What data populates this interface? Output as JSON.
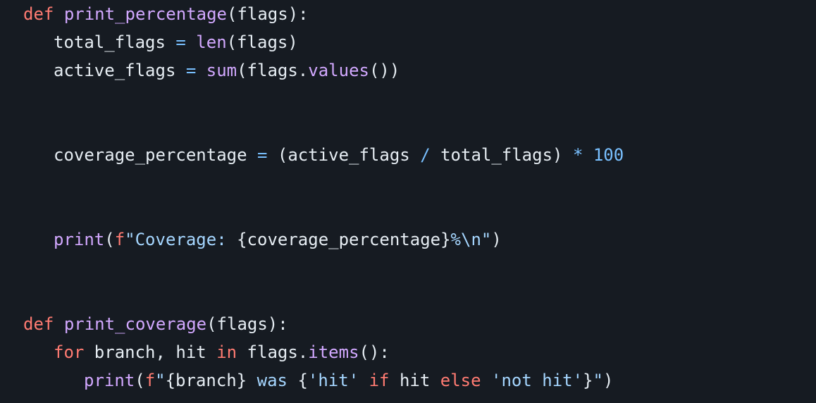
{
  "theme": {
    "background": "#161b22",
    "foreground": "#e6edf3",
    "keyword": "#ff7b72",
    "function": "#d2a8ff",
    "string": "#a5d6ff",
    "number": "#79c0ff",
    "operator": "#79c0ff"
  },
  "code": {
    "language": "python",
    "lines": [
      {
        "indent": 0,
        "tokens": [
          {
            "t": "def",
            "k": "kw"
          },
          {
            "t": " ",
            "k": "plain"
          },
          {
            "t": "print_percentage",
            "k": "fn"
          },
          {
            "t": "(flags):",
            "k": "plain"
          }
        ]
      },
      {
        "indent": 1,
        "tokens": [
          {
            "t": "total_flags ",
            "k": "plain"
          },
          {
            "t": "=",
            "k": "op"
          },
          {
            "t": " ",
            "k": "plain"
          },
          {
            "t": "len",
            "k": "fn"
          },
          {
            "t": "(flags)",
            "k": "plain"
          }
        ]
      },
      {
        "indent": 1,
        "tokens": [
          {
            "t": "active_flags ",
            "k": "plain"
          },
          {
            "t": "=",
            "k": "op"
          },
          {
            "t": " ",
            "k": "plain"
          },
          {
            "t": "sum",
            "k": "fn"
          },
          {
            "t": "(flags.",
            "k": "plain"
          },
          {
            "t": "values",
            "k": "fn"
          },
          {
            "t": "())",
            "k": "plain"
          }
        ]
      },
      {
        "indent": 0,
        "tokens": []
      },
      {
        "indent": 0,
        "tokens": []
      },
      {
        "indent": 1,
        "tokens": [
          {
            "t": "coverage_percentage ",
            "k": "plain"
          },
          {
            "t": "=",
            "k": "op"
          },
          {
            "t": " (active_flags ",
            "k": "plain"
          },
          {
            "t": "/",
            "k": "op"
          },
          {
            "t": " total_flags) ",
            "k": "plain"
          },
          {
            "t": "*",
            "k": "op"
          },
          {
            "t": " ",
            "k": "plain"
          },
          {
            "t": "100",
            "k": "num"
          }
        ]
      },
      {
        "indent": 0,
        "tokens": []
      },
      {
        "indent": 0,
        "tokens": []
      },
      {
        "indent": 1,
        "tokens": [
          {
            "t": "print",
            "k": "fn"
          },
          {
            "t": "(",
            "k": "plain"
          },
          {
            "t": "f",
            "k": "kw"
          },
          {
            "t": "\"Coverage: ",
            "k": "str"
          },
          {
            "t": "{coverage_percentage}",
            "k": "plain"
          },
          {
            "t": "%\\n\"",
            "k": "str"
          },
          {
            "t": ")",
            "k": "plain"
          }
        ]
      },
      {
        "indent": 0,
        "tokens": []
      },
      {
        "indent": 0,
        "tokens": []
      },
      {
        "indent": 0,
        "tokens": [
          {
            "t": "def",
            "k": "kw"
          },
          {
            "t": " ",
            "k": "plain"
          },
          {
            "t": "print_coverage",
            "k": "fn"
          },
          {
            "t": "(flags):",
            "k": "plain"
          }
        ]
      },
      {
        "indent": 1,
        "tokens": [
          {
            "t": "for",
            "k": "kw"
          },
          {
            "t": " branch, hit ",
            "k": "plain"
          },
          {
            "t": "in",
            "k": "kw"
          },
          {
            "t": " flags.",
            "k": "plain"
          },
          {
            "t": "items",
            "k": "fn"
          },
          {
            "t": "():",
            "k": "plain"
          }
        ]
      },
      {
        "indent": 2,
        "tokens": [
          {
            "t": "print",
            "k": "fn"
          },
          {
            "t": "(",
            "k": "plain"
          },
          {
            "t": "f",
            "k": "kw"
          },
          {
            "t": "\"",
            "k": "str"
          },
          {
            "t": "{branch}",
            "k": "plain"
          },
          {
            "t": " was ",
            "k": "str"
          },
          {
            "t": "{",
            "k": "plain"
          },
          {
            "t": "'hit'",
            "k": "str"
          },
          {
            "t": " ",
            "k": "plain"
          },
          {
            "t": "if",
            "k": "kw"
          },
          {
            "t": " hit ",
            "k": "plain"
          },
          {
            "t": "else",
            "k": "kw"
          },
          {
            "t": " ",
            "k": "plain"
          },
          {
            "t": "'not hit'",
            "k": "str"
          },
          {
            "t": "}",
            "k": "plain"
          },
          {
            "t": "\"",
            "k": "str"
          },
          {
            "t": ")",
            "k": "plain"
          }
        ]
      }
    ]
  }
}
